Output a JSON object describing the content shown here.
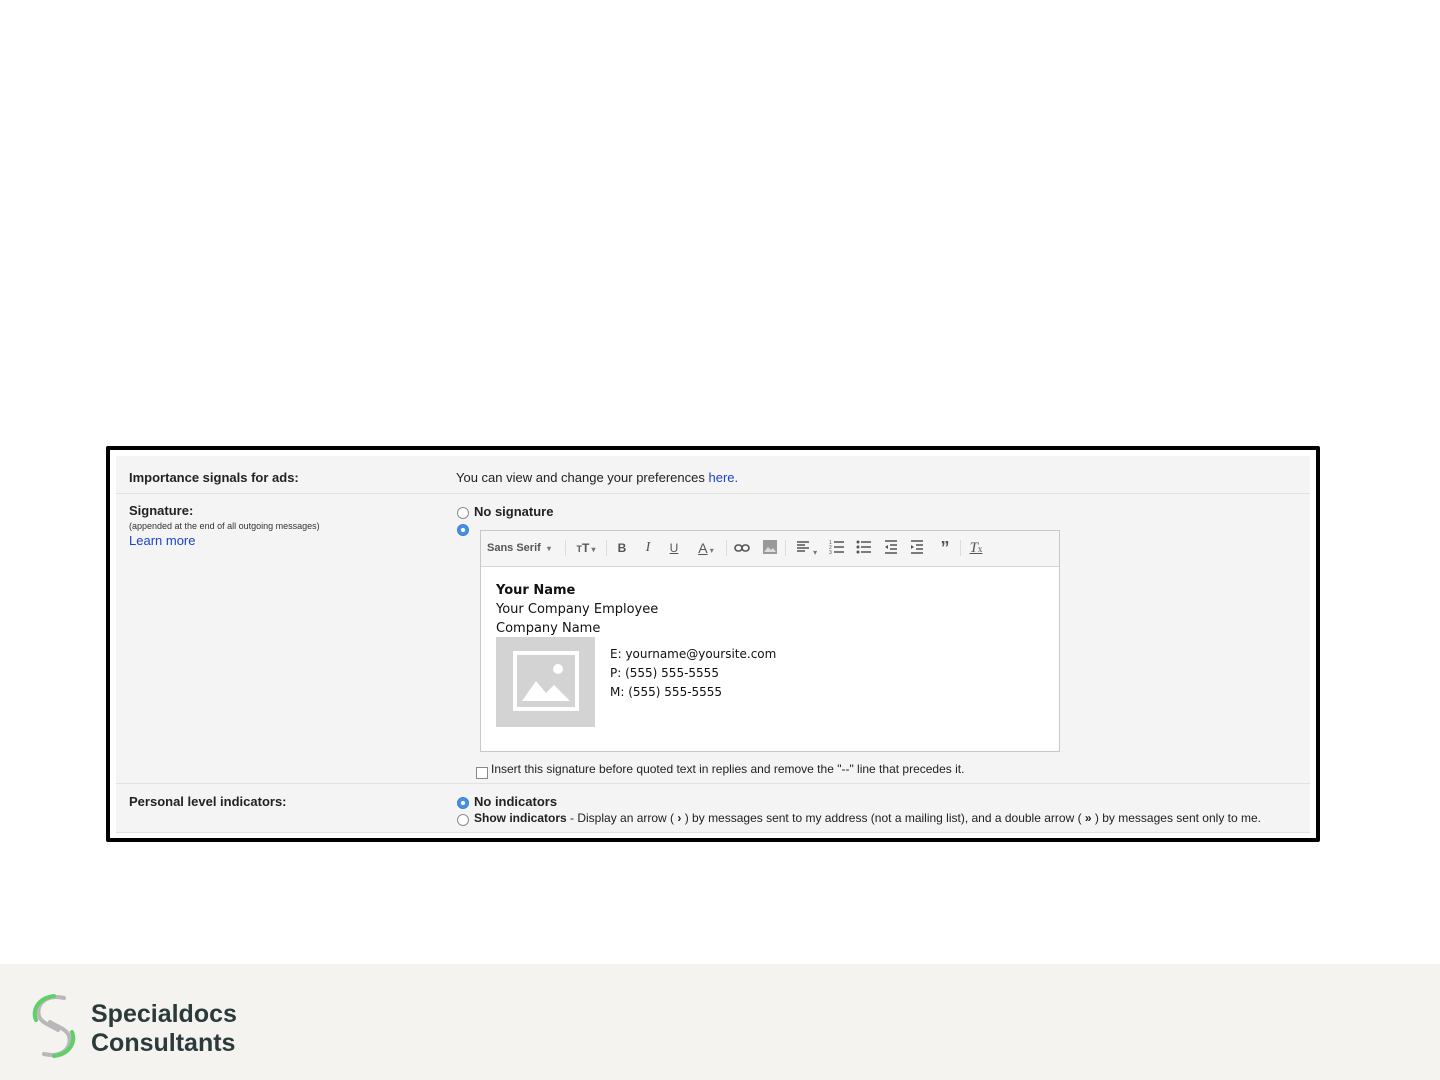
{
  "importance": {
    "label": "Importance signals for ads:",
    "text": "You can view and change your preferences",
    "link": "here."
  },
  "signature": {
    "label": "Signature:",
    "sublabel": "(appended at the end of all outgoing messages)",
    "learn_more": "Learn more",
    "no_signature": "No signature",
    "toolbar": {
      "font": "Sans Serif"
    },
    "body": {
      "name": "Your Name",
      "title": "Your Company Employee",
      "company": "Company Name",
      "email": "E: yourname@yoursite.com",
      "phone": "P: (555) 555-5555",
      "mobile": "M: (555) 555-5555"
    },
    "insert_before_quoted": "Insert this signature before quoted text in replies and remove the \"--\" line that precedes it."
  },
  "personal": {
    "label": "Personal level indicators:",
    "no_indicators": "No indicators",
    "show_indicators": "Show indicators",
    "show_desc_1": " - Display an arrow ( ",
    "single_arrow": "›",
    "show_desc_2": " ) by messages sent to my address (not a mailing list), and a double arrow ( ",
    "double_arrow": "»",
    "show_desc_3": " ) by messages sent only to me."
  },
  "footer": {
    "brand_line1": "Specialdocs",
    "brand_line2": "Consultants"
  },
  "colors": {
    "link": "#1a44c9",
    "radio_on": "#4a90e2",
    "logo_green": "#5fcf6a",
    "logo_gray": "#b8b8b8"
  }
}
